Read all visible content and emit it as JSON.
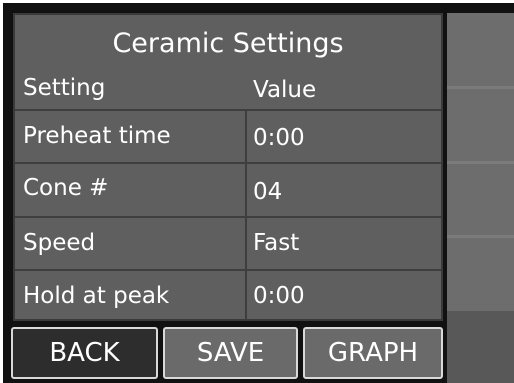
{
  "panel": {
    "title": "Ceramic Settings",
    "header": {
      "setting": "Setting",
      "value": "Value"
    },
    "rows": [
      {
        "label": "Preheat time",
        "value": "0:00"
      },
      {
        "label": "Cone #",
        "value": "04"
      },
      {
        "label": "Speed",
        "value": "Fast"
      },
      {
        "label": "Hold at peak",
        "value": "0:00"
      }
    ]
  },
  "buttons": {
    "back": "BACK",
    "save": "SAVE",
    "graph": "GRAPH"
  }
}
